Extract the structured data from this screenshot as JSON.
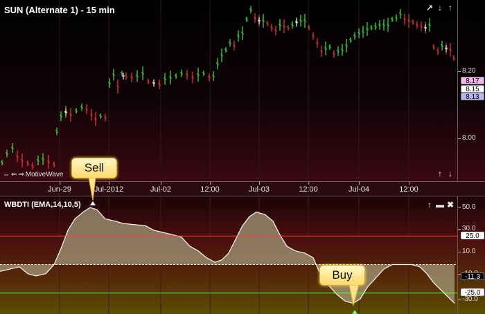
{
  "price_panel": {
    "title": "SUN (Alternate 1) - 15 min",
    "watermark": "MotiveWave",
    "axis_ticks": [
      "8.20",
      "8.00"
    ],
    "price_flags": [
      {
        "label": "8.17",
        "color": "#f3b7f0"
      },
      {
        "label": "8.15",
        "color": "#ffffff"
      },
      {
        "label": "8.13",
        "color": "#b7b7f5"
      }
    ],
    "corner_top": [
      "↗",
      "↓",
      "↑"
    ],
    "corner_bottom": [
      "↑",
      "↓"
    ]
  },
  "time_axis": {
    "labels": [
      "Jun-29",
      "Jul-2012",
      "Jul-02",
      "12:00",
      "Jul-03",
      "12:00",
      "Jul-04",
      "12:00"
    ]
  },
  "indicator": {
    "title": "WBDTI (EMA,14,10,5)",
    "axis_ticks": [
      "50.0",
      "30.0",
      "10.0",
      "-10.0",
      "-30.0"
    ],
    "flags": [
      {
        "label": "25.0",
        "bg": "#ffffff",
        "fg": "#000000"
      },
      {
        "label": "-11.3",
        "bg": "#000000",
        "fg": "#ffffff"
      },
      {
        "label": "-25.0",
        "bg": "#ffffff",
        "fg": "#000000"
      }
    ],
    "corner": [
      "↑",
      "▬",
      "✖"
    ],
    "colors": {
      "overbought_line": "#ff4040",
      "oversold_line": "#60ff40",
      "zero_line": "#ffffff"
    }
  },
  "signals": [
    {
      "label": "Sell"
    },
    {
      "label": "Buy"
    }
  ]
}
